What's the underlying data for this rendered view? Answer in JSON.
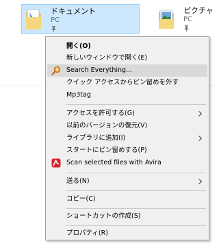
{
  "files": [
    {
      "name": "ドキュメント",
      "subtitle": "PC",
      "selected": true
    },
    {
      "name": "ピクチャ",
      "subtitle": "PC",
      "selected": false
    }
  ],
  "context_menu": {
    "items": [
      {
        "label": "開く(O)"
      },
      {
        "label": "新しいウィンドウで開く(E)"
      },
      {
        "label": "Search Everything...",
        "icon": "search-everything-icon"
      },
      {
        "label": "クイック アクセスからピン留めを外す"
      },
      {
        "label": "Mp3tag"
      },
      {
        "label": "アクセスを許可する(G)"
      },
      {
        "label": "以前のバージョンの復元(V)"
      },
      {
        "label": "ライブラリに追加(I)"
      },
      {
        "label": "スタートにピン留めする(P)"
      },
      {
        "label": "Scan selected files with Avira",
        "icon": "avira-icon"
      },
      {
        "label": "送る(N)"
      },
      {
        "label": "コピー(C)"
      },
      {
        "label": "ショートカットの作成(S)"
      },
      {
        "label": "プロパティ(R)"
      }
    ]
  },
  "colors": {
    "selection_bg": "#cce8ff",
    "menu_bg": "#f0f0f0",
    "hover_bg": "#d9d9d9",
    "avira_red": "#d9232d"
  }
}
